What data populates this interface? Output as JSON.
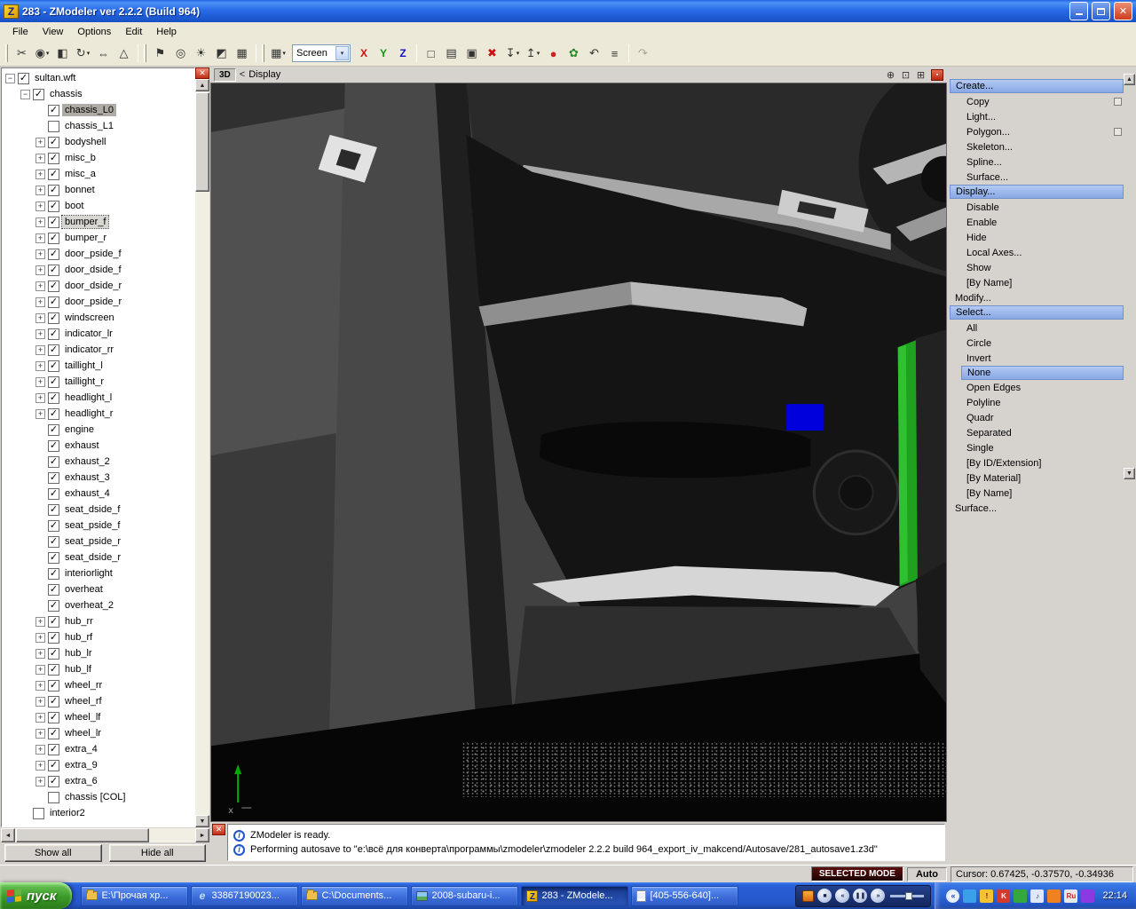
{
  "window": {
    "title": "283 - ZModeler ver 2.2.2 (Build 964)",
    "icon_letter": "Z"
  },
  "icons": {
    "chevron_down": "▾",
    "close": "✕",
    "scroll_up": "▲",
    "scroll_down": "▼",
    "scroll_left": "◄",
    "scroll_right": "►"
  },
  "menubar": {
    "items": [
      "File",
      "View",
      "Options",
      "Edit",
      "Help"
    ]
  },
  "toolbar": {
    "groupA": [
      {
        "name": "cut-tool",
        "glyph": "✂"
      },
      {
        "name": "snap-toggle",
        "glyph": "◉",
        "dd": true
      },
      {
        "name": "mirror-tool",
        "glyph": "◧"
      },
      {
        "name": "rotate-tool",
        "glyph": "↻",
        "dd": true
      },
      {
        "name": "scale-tool",
        "glyph": "⇔"
      },
      {
        "name": "normals-tool",
        "glyph": "△"
      }
    ],
    "groupB": [
      {
        "name": "flag-tool",
        "glyph": "⚑"
      },
      {
        "name": "camera-view",
        "glyph": "◎"
      },
      {
        "name": "light-tool",
        "glyph": "☀"
      },
      {
        "name": "material-editor",
        "glyph": "◩"
      },
      {
        "name": "uv-mapper",
        "glyph": "▦"
      }
    ],
    "views_button": {
      "name": "views-config",
      "glyph": "▦",
      "dd": true
    },
    "screen_combo": {
      "value": "Screen"
    },
    "axis": [
      {
        "label": "X",
        "color": "#cc1111"
      },
      {
        "label": "Y",
        "color": "#119911"
      },
      {
        "label": "Z",
        "color": "#1111cc"
      }
    ],
    "groupC": [
      {
        "name": "new-file",
        "glyph": "□"
      },
      {
        "name": "open-file",
        "glyph": "▤"
      },
      {
        "name": "save-file",
        "glyph": "▣"
      },
      {
        "name": "delete",
        "glyph": "✖",
        "color": "#cc1111"
      },
      {
        "name": "import",
        "glyph": "↧",
        "dd": true
      },
      {
        "name": "export",
        "glyph": "↥",
        "dd": true
      },
      {
        "name": "record",
        "glyph": "●",
        "color": "#cc2222"
      },
      {
        "name": "plugins",
        "glyph": "✿",
        "color": "#2a8a2a"
      },
      {
        "name": "undo",
        "glyph": "↶"
      },
      {
        "name": "script-list",
        "glyph": "≡"
      }
    ],
    "groupD": [
      {
        "name": "redo",
        "glyph": "↷",
        "disabled": true
      }
    ]
  },
  "tree": {
    "show_all": "Show all",
    "hide_all": "Hide all",
    "items": [
      {
        "l": "sultan.wft",
        "lv": 0,
        "c": 1,
        "e": "m"
      },
      {
        "l": "chassis",
        "lv": 1,
        "c": 1,
        "e": "m"
      },
      {
        "l": "chassis_L0",
        "lv": 2,
        "c": 1,
        "sel": true
      },
      {
        "l": "chassis_L1",
        "lv": 2,
        "c": 0
      },
      {
        "l": "bodyshell",
        "lv": 2,
        "c": 1,
        "e": "p"
      },
      {
        "l": "misc_b",
        "lv": 2,
        "c": 1,
        "e": "p"
      },
      {
        "l": "misc_a",
        "lv": 2,
        "c": 1,
        "e": "p"
      },
      {
        "l": "bonnet",
        "lv": 2,
        "c": 1,
        "e": "p"
      },
      {
        "l": "boot",
        "lv": 2,
        "c": 1,
        "e": "p"
      },
      {
        "l": "bumper_f",
        "lv": 2,
        "c": 1,
        "e": "p",
        "foc": true
      },
      {
        "l": "bumper_r",
        "lv": 2,
        "c": 1,
        "e": "p"
      },
      {
        "l": "door_pside_f",
        "lv": 2,
        "c": 1,
        "e": "p"
      },
      {
        "l": "door_dside_f",
        "lv": 2,
        "c": 1,
        "e": "p"
      },
      {
        "l": "door_dside_r",
        "lv": 2,
        "c": 1,
        "e": "p"
      },
      {
        "l": "door_pside_r",
        "lv": 2,
        "c": 1,
        "e": "p"
      },
      {
        "l": "windscreen",
        "lv": 2,
        "c": 1,
        "e": "p"
      },
      {
        "l": "indicator_lr",
        "lv": 2,
        "c": 1,
        "e": "p"
      },
      {
        "l": "indicator_rr",
        "lv": 2,
        "c": 1,
        "e": "p"
      },
      {
        "l": "taillight_l",
        "lv": 2,
        "c": 1,
        "e": "p"
      },
      {
        "l": "taillight_r",
        "lv": 2,
        "c": 1,
        "e": "p"
      },
      {
        "l": "headlight_l",
        "lv": 2,
        "c": 1,
        "e": "p"
      },
      {
        "l": "headlight_r",
        "lv": 2,
        "c": 1,
        "e": "p"
      },
      {
        "l": "engine",
        "lv": 2,
        "c": 1
      },
      {
        "l": "exhaust",
        "lv": 2,
        "c": 1
      },
      {
        "l": "exhaust_2",
        "lv": 2,
        "c": 1
      },
      {
        "l": "exhaust_3",
        "lv": 2,
        "c": 1
      },
      {
        "l": "exhaust_4",
        "lv": 2,
        "c": 1
      },
      {
        "l": "seat_dside_f",
        "lv": 2,
        "c": 1
      },
      {
        "l": "seat_pside_f",
        "lv": 2,
        "c": 1
      },
      {
        "l": "seat_pside_r",
        "lv": 2,
        "c": 1
      },
      {
        "l": "seat_dside_r",
        "lv": 2,
        "c": 1
      },
      {
        "l": "interiorlight",
        "lv": 2,
        "c": 1
      },
      {
        "l": "overheat",
        "lv": 2,
        "c": 1
      },
      {
        "l": "overheat_2",
        "lv": 2,
        "c": 1
      },
      {
        "l": "hub_rr",
        "lv": 2,
        "c": 1,
        "e": "p"
      },
      {
        "l": "hub_rf",
        "lv": 2,
        "c": 1,
        "e": "p"
      },
      {
        "l": "hub_lr",
        "lv": 2,
        "c": 1,
        "e": "p"
      },
      {
        "l": "hub_lf",
        "lv": 2,
        "c": 1,
        "e": "p"
      },
      {
        "l": "wheel_rr",
        "lv": 2,
        "c": 1,
        "e": "p"
      },
      {
        "l": "wheel_rf",
        "lv": 2,
        "c": 1,
        "e": "p"
      },
      {
        "l": "wheel_lf",
        "lv": 2,
        "c": 1,
        "e": "p"
      },
      {
        "l": "wheel_lr",
        "lv": 2,
        "c": 1,
        "e": "p"
      },
      {
        "l": "extra_4",
        "lv": 2,
        "c": 1,
        "e": "p"
      },
      {
        "l": "extra_9",
        "lv": 2,
        "c": 1,
        "e": "p"
      },
      {
        "l": "extra_6",
        "lv": 2,
        "c": 1,
        "e": "p"
      },
      {
        "l": "chassis [COL]",
        "lv": 2,
        "c": 0
      },
      {
        "l": "interior2",
        "lv": 1,
        "c": 0
      }
    ]
  },
  "viewport": {
    "mode": "3D",
    "back": "<",
    "label": "Display",
    "header_icons": [
      {
        "name": "zoom-extents",
        "glyph": "⊕"
      },
      {
        "name": "zoom-region",
        "glyph": "⊡"
      },
      {
        "name": "pan-view",
        "glyph": "⊞"
      }
    ],
    "layout_glyph": "▪"
  },
  "right_panel": {
    "items": [
      {
        "l": "Create...",
        "t": "h"
      },
      {
        "l": "Copy",
        "t": "i",
        "box": true
      },
      {
        "l": "Light...",
        "t": "i"
      },
      {
        "l": "Polygon...",
        "t": "i",
        "box": true
      },
      {
        "l": "Skeleton...",
        "t": "i"
      },
      {
        "l": "Spline...",
        "t": "i"
      },
      {
        "l": "Surface...",
        "t": "i"
      },
      {
        "l": "Display...",
        "t": "h"
      },
      {
        "l": "Disable",
        "t": "i"
      },
      {
        "l": "Enable",
        "t": "i"
      },
      {
        "l": "Hide",
        "t": "i"
      },
      {
        "l": "Local Axes...",
        "t": "i"
      },
      {
        "l": "Show",
        "t": "i"
      },
      {
        "l": "[By Name]",
        "t": "i"
      },
      {
        "l": "Modify...",
        "t": "r"
      },
      {
        "l": "Select...",
        "t": "h"
      },
      {
        "l": "All",
        "t": "i"
      },
      {
        "l": "Circle",
        "t": "i"
      },
      {
        "l": "Invert",
        "t": "i"
      },
      {
        "l": "None",
        "t": "i",
        "sel": true
      },
      {
        "l": "Open Edges",
        "t": "i"
      },
      {
        "l": "Polyline",
        "t": "i"
      },
      {
        "l": "Quadr",
        "t": "i"
      },
      {
        "l": "Separated",
        "t": "i"
      },
      {
        "l": "Single",
        "t": "i"
      },
      {
        "l": "[By ID/Extension]",
        "t": "i"
      },
      {
        "l": "[By Material]",
        "t": "i"
      },
      {
        "l": "[By Name]",
        "t": "i"
      },
      {
        "l": "Surface...",
        "t": "r"
      }
    ]
  },
  "status_messages": [
    "ZModeler is ready.",
    "Performing autosave to \"e:\\всё для конверта\\программы\\zmodeler\\zmodeler 2.2.2 build 964_export_iv_makcend/Autosave/281_autosave1.z3d\""
  ],
  "statusbar": {
    "mode": "SELECTED MODE",
    "auto_label": "Auto",
    "cursor": "Cursor: 0.67425, -0.37570, -0.34936"
  },
  "taskbar": {
    "start_label": "пуск",
    "tasks": [
      {
        "label": "Е:\\Прочая хр...",
        "icon": "folder"
      },
      {
        "label": "33867190023...",
        "icon": "ie"
      },
      {
        "label": "C:\\Documents...",
        "icon": "folder"
      },
      {
        "label": "2008-subaru-i...",
        "icon": "image"
      },
      {
        "label": "283 - ZModele...",
        "icon": "zmodeler",
        "active": true
      },
      {
        "label": "[405-556-640]...",
        "icon": "notepad"
      }
    ],
    "media_buttons": [
      {
        "name": "stop",
        "glyph": "■"
      },
      {
        "name": "previous",
        "glyph": "«"
      },
      {
        "name": "play-pause",
        "glyph": "❚❚"
      },
      {
        "name": "next",
        "glyph": "»"
      }
    ],
    "tray": {
      "chevron": "«",
      "icons": [
        {
          "name": "tray-icon-1",
          "bg": "#3aa0e8",
          "glyph": ""
        },
        {
          "name": "tray-icon-2",
          "bg": "#f4c430",
          "glyph": "!",
          "fg": "#703"
        },
        {
          "name": "tray-icon-3",
          "bg": "#d23a2a",
          "glyph": "K"
        },
        {
          "name": "tray-icon-4",
          "bg": "#35a83c",
          "glyph": ""
        },
        {
          "name": "tray-volume",
          "bg": "#dfe8f8",
          "glyph": "♪",
          "fg": "#234"
        },
        {
          "name": "tray-icon-6",
          "bg": "#f08020",
          "glyph": ""
        },
        {
          "name": "tray-language",
          "bg": "#e8e8e8",
          "glyph": "Ru",
          "fg": "#c22"
        },
        {
          "name": "tray-icon-8",
          "bg": "#8a3ae0",
          "glyph": ""
        }
      ],
      "clock": "22:14"
    }
  }
}
